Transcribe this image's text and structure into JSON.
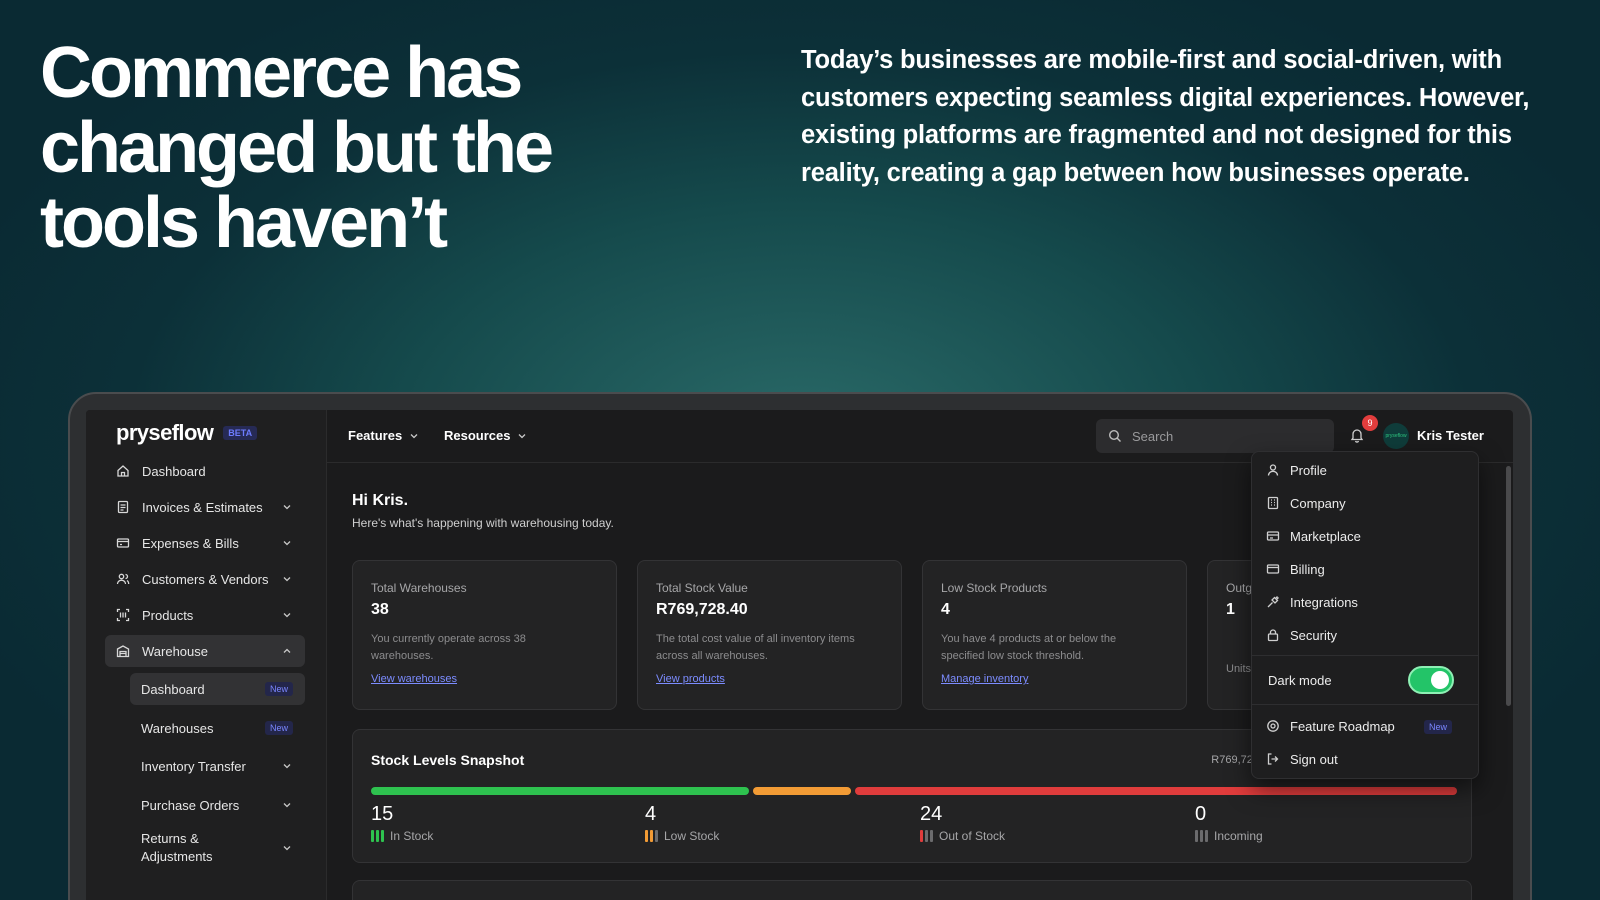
{
  "hero": {
    "headline": "Commerce has changed but the tools haven’t",
    "intro": "Today’s businesses are mobile-first and social-driven, with customers expecting seamless digital experiences. However, existing platforms are fragmented and not designed for this reality, creating a gap between how businesses operate."
  },
  "app": {
    "logo": "pryseflow",
    "beta": "BETA",
    "sidebar": {
      "items": [
        {
          "label": "Dashboard",
          "icon": "home-icon"
        },
        {
          "label": "Invoices & Estimates",
          "icon": "invoice-icon"
        },
        {
          "label": "Expenses & Bills",
          "icon": "bill-icon"
        },
        {
          "label": "Customers & Vendors",
          "icon": "users-icon"
        },
        {
          "label": "Products",
          "icon": "barcode-icon"
        },
        {
          "label": "Warehouse",
          "icon": "warehouse-icon"
        }
      ],
      "warehouse_sub": [
        {
          "label": "Dashboard",
          "badge": "New"
        },
        {
          "label": "Warehouses",
          "badge": "New"
        },
        {
          "label": "Inventory Transfer"
        },
        {
          "label": "Purchase Orders"
        },
        {
          "label": "Returns & Adjustments"
        }
      ]
    },
    "topnav": {
      "features": "Features",
      "resources": "Resources",
      "search_placeholder": "Search",
      "notifications": "9",
      "avatar_text": "pryseflow",
      "user": "Kris Tester"
    },
    "greeting": {
      "title": "Hi Kris.",
      "subtitle": "Here's what's happening with warehousing today."
    },
    "cards": [
      {
        "label": "Total Warehouses",
        "value": "38",
        "desc": "You currently operate across 38 warehouses.",
        "link": "View warehouses"
      },
      {
        "label": "Total Stock Value",
        "value": "R769,728.40",
        "desc": "The total cost value of all inventory items across all warehouses.",
        "link": "View products"
      },
      {
        "label": "Low Stock Products",
        "value": "4",
        "desc": "You have 4 products at or below the specified low stock threshold.",
        "link": "Manage inventory"
      },
      {
        "label": "Outgo",
        "value": "1",
        "desc": "Units s",
        "link": ""
      }
    ],
    "snapshot": {
      "title": "Stock Levels Snapshot",
      "total": "R769,728",
      "stats": [
        {
          "value": "15",
          "label": "In Stock",
          "color": "#2ec24f"
        },
        {
          "value": "4",
          "label": "Low Stock",
          "color": "#f29b35"
        },
        {
          "value": "24",
          "label": "Out of Stock",
          "color": "#e03c3c"
        },
        {
          "value": "0",
          "label": "Incoming",
          "color": "#6b6b6d"
        }
      ]
    },
    "user_menu": {
      "items": [
        "Profile",
        "Company",
        "Marketplace",
        "Billing",
        "Integrations",
        "Security"
      ],
      "dark_mode": "Dark mode",
      "dark_mode_on": true,
      "roadmap": "Feature Roadmap",
      "roadmap_badge": "New",
      "sign_out": "Sign out"
    }
  }
}
